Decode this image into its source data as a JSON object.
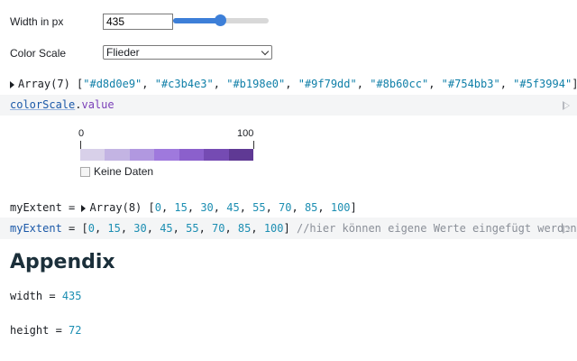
{
  "controls": {
    "width_label": "Width in px",
    "width_value": "435",
    "slider_fraction": 0.49,
    "scale_label": "Color Scale",
    "scale_selected": "Flieder"
  },
  "array_line": {
    "prefix": "Array(7) [",
    "colors": [
      "#d8d0e9",
      "#c3b4e3",
      "#b198e0",
      "#9f79dd",
      "#8b60cc",
      "#754bb3",
      "#5f3994"
    ],
    "suffix": "]"
  },
  "color_scale_cell": {
    "object": "colorScale",
    "dot": ".",
    "property": "value"
  },
  "legend": {
    "tick_min": "0",
    "tick_max": "100",
    "swatches": [
      "#d8d0e9",
      "#c3b4e3",
      "#b198e0",
      "#9f79dd",
      "#8b60cc",
      "#754bb3",
      "#5f3994"
    ],
    "no_data_label": "Keine Daten"
  },
  "extent_output": {
    "name": "myExtent",
    "equals": " = ",
    "prefix": "Array(8) [",
    "values": [
      "0",
      "15",
      "30",
      "45",
      "55",
      "70",
      "85",
      "100"
    ],
    "suffix": "]"
  },
  "extent_cell": {
    "name": "myExtent",
    "equals": " = [",
    "values": [
      "0",
      "15",
      "30",
      "45",
      "55",
      "70",
      "85",
      "100"
    ],
    "suffix": "]",
    "comment": "//hier können eigene Werte eingefügt werden"
  },
  "appendix_heading": "Appendix",
  "width_cell": {
    "name": "width",
    "equals": " = ",
    "value": "435"
  },
  "height_cell": {
    "name": "height",
    "equals": " = ",
    "value": "72"
  }
}
